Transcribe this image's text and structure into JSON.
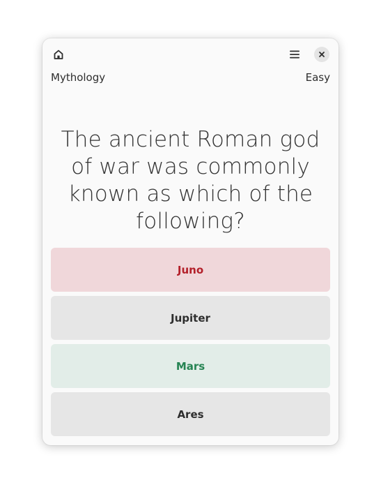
{
  "header": {
    "home_icon": "home-icon",
    "menu_icon": "hamburger-menu-icon",
    "close_icon": "close-icon"
  },
  "quiz": {
    "category": "Mythology",
    "difficulty": "Easy",
    "question": "The ancient Roman god of war was commonly known as which of the following?",
    "answers": [
      {
        "label": "Juno",
        "state": "wrong"
      },
      {
        "label": "Jupiter",
        "state": "neutral"
      },
      {
        "label": "Mars",
        "state": "correct"
      },
      {
        "label": "Ares",
        "state": "neutral"
      }
    ]
  },
  "colors": {
    "wrong_bg": "#f0d7da",
    "wrong_text": "#b3202a",
    "correct_bg": "#e2ede8",
    "correct_text": "#268453",
    "neutral_bg": "#e6e6e6"
  }
}
